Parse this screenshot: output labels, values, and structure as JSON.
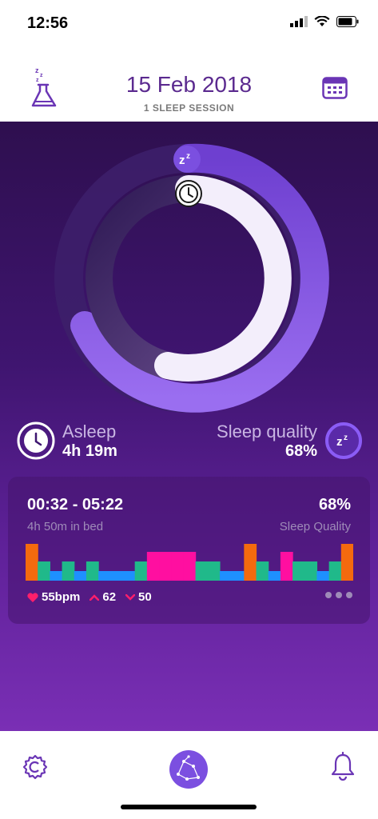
{
  "status_bar": {
    "time": "12:56"
  },
  "header": {
    "date": "15 Feb 2018",
    "sessions": "1 SLEEP SESSION",
    "flask_icon": "flask-icon",
    "calendar_icon": "calendar-icon"
  },
  "ring": {
    "sleep_badge": "zz",
    "clock_badge": "clock-icon"
  },
  "asleep": {
    "label": "Asleep",
    "value": "4h 19m"
  },
  "quality": {
    "label": "Sleep quality",
    "value": "68%",
    "badge": "zz"
  },
  "session": {
    "time_range": "00:32 - 05:22",
    "in_bed": "4h 50m in bed",
    "quality_value": "68%",
    "quality_label": "Sleep Quality",
    "heart_rate": "55bpm",
    "hr_high": "62",
    "hr_low": "50",
    "bar_colors": {
      "awake": "#f46a0e",
      "light": "#20b98a",
      "deep": "#1e90ff",
      "rem": "#ff0fa0"
    },
    "stages": [
      "awake",
      "light",
      "deep",
      "light",
      "deep",
      "light",
      "deep",
      "deep",
      "deep",
      "light",
      "rem",
      "rem",
      "rem",
      "rem",
      "light",
      "light",
      "deep",
      "deep",
      "awake",
      "light",
      "deep",
      "rem",
      "light",
      "light",
      "deep",
      "light",
      "awake"
    ]
  },
  "nav": {
    "settings_icon": "settings-gear-icon",
    "home_icon": "constellation-icon",
    "notifications_icon": "bell-icon"
  },
  "colors": {
    "brand": "#6a35b5",
    "accent": "#8b5cf6"
  }
}
